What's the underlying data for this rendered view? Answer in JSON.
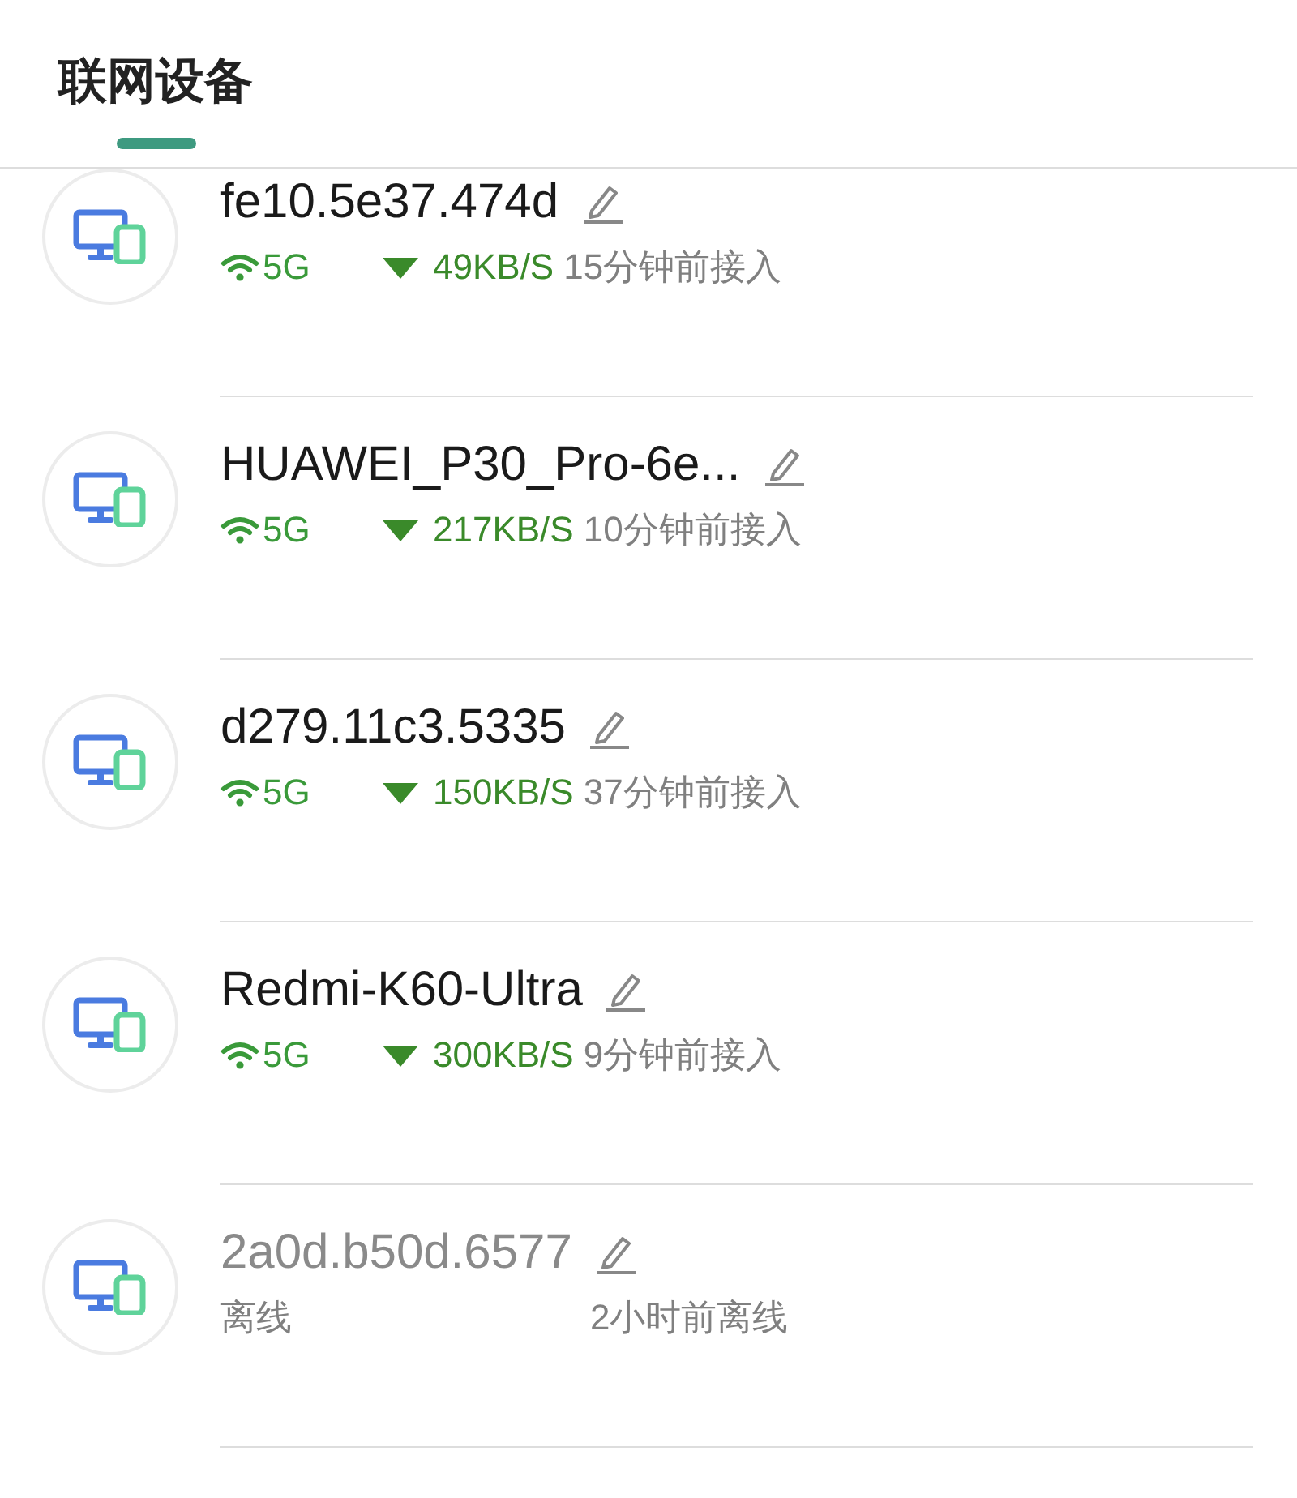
{
  "tabs": [
    {
      "label": "联网设备",
      "selected": true
    }
  ],
  "devices": [
    {
      "kind": "online",
      "name": "fe10.5e37.474d",
      "band": "5G",
      "speed": "49KB/S",
      "time": "15分钟前接入"
    },
    {
      "kind": "online",
      "name": "HUAWEI_P30_Pro-6e...",
      "band": "5G",
      "speed": "217KB/S",
      "time": "10分钟前接入"
    },
    {
      "kind": "online",
      "name": "d279.11c3.5335",
      "band": "5G",
      "speed": "150KB/S",
      "time": "37分钟前接入"
    },
    {
      "kind": "online",
      "name": "Redmi-K60-Ultra",
      "band": "5G",
      "speed": "300KB/S",
      "time": "9分钟前接入"
    },
    {
      "kind": "offline",
      "name": "2a0d.b50d.6577",
      "status": "离线",
      "time": "2小时前离线"
    }
  ]
}
